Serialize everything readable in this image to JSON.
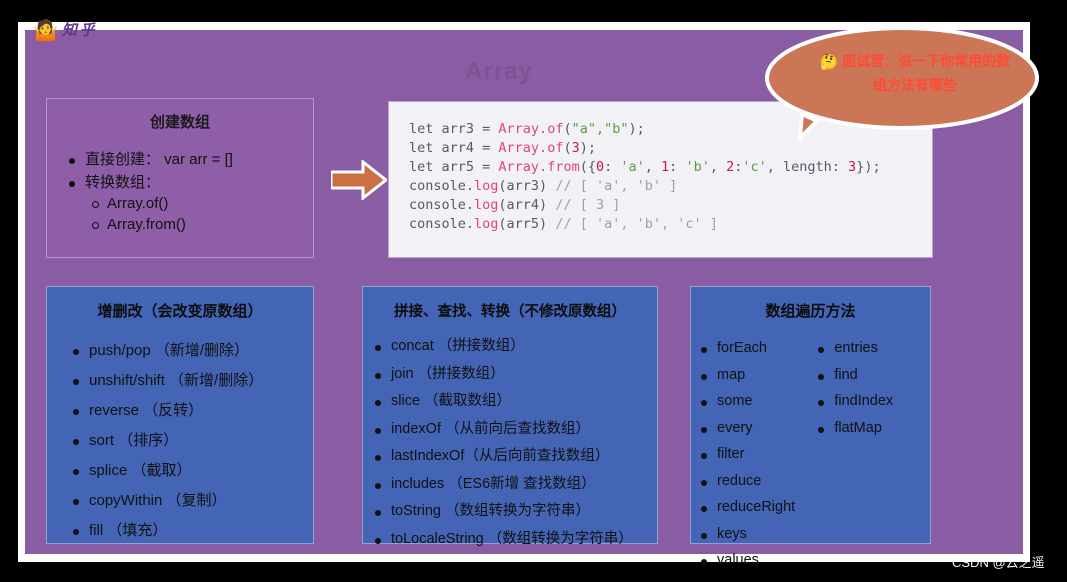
{
  "logo": {
    "emoji": "🤷",
    "text": "知 乎"
  },
  "slide": {
    "title": "Array"
  },
  "bubble": {
    "emoji": "🤔",
    "line1": "面试官：说一下你常用的数",
    "line2": "组方法有哪些",
    "fill_color": "#cc7658",
    "text_color": "#ff4b33"
  },
  "arrow": {
    "name": "right-arrow",
    "color": "#cc7043"
  },
  "card_create": {
    "title": "创建数组",
    "items": [
      {
        "text": "直接创建：  var arr = []"
      },
      {
        "text": "转换数组：",
        "children": [
          "Array.of()",
          "Array.from()"
        ]
      }
    ]
  },
  "code": {
    "lines": [
      [
        {
          "t": "let arr3 ",
          "c": "tok-kw"
        },
        {
          "t": "= ",
          "c": "tok-punc"
        },
        {
          "t": "Array.of",
          "c": "tok-fn"
        },
        {
          "t": "(",
          "c": "tok-punc"
        },
        {
          "t": "\"a\",\"b\"",
          "c": "tok-str"
        },
        {
          "t": ");",
          "c": "tok-punc"
        }
      ],
      [
        {
          "t": "let arr4 ",
          "c": "tok-kw"
        },
        {
          "t": "= ",
          "c": "tok-punc"
        },
        {
          "t": "Array.of",
          "c": "tok-fn"
        },
        {
          "t": "(",
          "c": "tok-punc"
        },
        {
          "t": "3",
          "c": "tok-num"
        },
        {
          "t": ");",
          "c": "tok-punc"
        }
      ],
      [
        {
          "t": "let arr5 ",
          "c": "tok-kw"
        },
        {
          "t": "= ",
          "c": "tok-punc"
        },
        {
          "t": "Array.from",
          "c": "tok-fn"
        },
        {
          "t": "({",
          "c": "tok-punc"
        },
        {
          "t": "0",
          "c": "tok-num"
        },
        {
          "t": ": ",
          "c": "tok-punc"
        },
        {
          "t": "'a'",
          "c": "tok-str"
        },
        {
          "t": ", ",
          "c": "tok-punc"
        },
        {
          "t": "1",
          "c": "tok-num"
        },
        {
          "t": ": ",
          "c": "tok-punc"
        },
        {
          "t": "'b'",
          "c": "tok-str"
        },
        {
          "t": ", ",
          "c": "tok-punc"
        },
        {
          "t": "2",
          "c": "tok-num"
        },
        {
          "t": ":",
          "c": "tok-punc"
        },
        {
          "t": "'c'",
          "c": "tok-str"
        },
        {
          "t": ", length: ",
          "c": "tok-punc"
        },
        {
          "t": "3",
          "c": "tok-num"
        },
        {
          "t": "});",
          "c": "tok-punc"
        }
      ],
      [
        {
          "t": "console.",
          "c": "tok-kw"
        },
        {
          "t": "log",
          "c": "tok-fn"
        },
        {
          "t": "(arr3) ",
          "c": "tok-punc"
        },
        {
          "t": "// [ 'a', 'b' ]",
          "c": "tok-com"
        }
      ],
      [
        {
          "t": "console.",
          "c": "tok-kw"
        },
        {
          "t": "log",
          "c": "tok-fn"
        },
        {
          "t": "(arr4) ",
          "c": "tok-punc"
        },
        {
          "t": "// [ 3 ]",
          "c": "tok-com"
        }
      ],
      [
        {
          "t": "console.",
          "c": "tok-kw"
        },
        {
          "t": "log",
          "c": "tok-fn"
        },
        {
          "t": "(arr5) ",
          "c": "tok-punc"
        },
        {
          "t": "// [ 'a', 'b', 'c' ]",
          "c": "tok-com"
        }
      ]
    ]
  },
  "card_mutate": {
    "title": "增删改（会改变原数组）",
    "items": [
      "push/pop （新增/删除）",
      "unshift/shift （新增/删除）",
      "reverse （反转）",
      "sort （排序）",
      "splice （截取）",
      "copyWithin （复制）",
      "fill （填充）"
    ]
  },
  "card_nonmutate": {
    "title": "拼接、查找、转换（不修改原数组）",
    "items": [
      "concat （拼接数组）",
      "join （拼接数组）",
      "slice （截取数组）",
      "indexOf （从前向后查找数组）",
      "lastIndexOf（从后向前查找数组）",
      "includes （ES6新增 查找数组）",
      "toString （数组转换为字符串）",
      "toLocaleString （数组转换为字符串）"
    ]
  },
  "card_iterate": {
    "title": "数组遍历方法",
    "left_items": [
      "forEach",
      "map",
      "some",
      "every",
      "filter",
      "reduce",
      "reduceRight",
      "keys",
      "values"
    ],
    "right_items": [
      "entries",
      "find",
      "findIndex",
      "flatMap"
    ]
  },
  "watermark": {
    "text": "CSDN @云之遥"
  },
  "colors": {
    "slide_bg": "#8a5ca3",
    "card_purple": "#8e5fa8",
    "card_blue": "#4465b5",
    "code_bg": "#f2f1f6",
    "bubble": "#cc7658",
    "arrow": "#cc7043"
  }
}
